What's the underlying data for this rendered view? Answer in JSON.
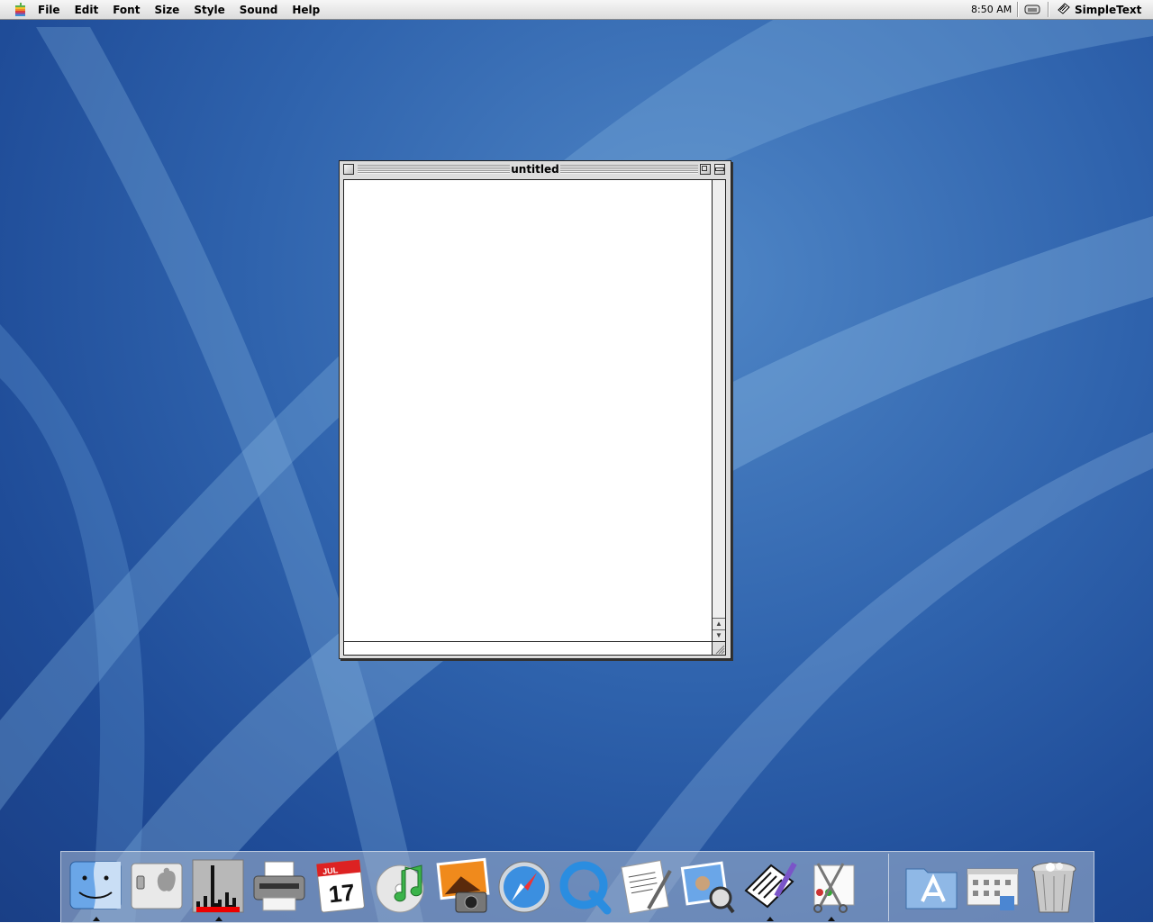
{
  "menubar": {
    "items": [
      "File",
      "Edit",
      "Font",
      "Size",
      "Style",
      "Sound",
      "Help"
    ],
    "clock": "8:50 AM",
    "active_app": "SimpleText"
  },
  "window": {
    "title": "untitled"
  },
  "dock": {
    "items": [
      {
        "name": "finder",
        "icon": "finder-icon",
        "running": true
      },
      {
        "name": "classic",
        "icon": "classic-icon",
        "running": false
      },
      {
        "name": "activity-monitor",
        "icon": "cpu-monitor-icon",
        "running": true
      },
      {
        "name": "printer-setup",
        "icon": "printer-icon",
        "running": false
      },
      {
        "name": "ical",
        "icon": "calendar-icon",
        "running": false,
        "calendar_month": "JUL",
        "calendar_day": "17"
      },
      {
        "name": "itunes",
        "icon": "itunes-icon",
        "running": false
      },
      {
        "name": "iphoto",
        "icon": "iphoto-icon",
        "running": false
      },
      {
        "name": "safari",
        "icon": "safari-icon",
        "running": false
      },
      {
        "name": "quicktime",
        "icon": "quicktime-icon",
        "running": false
      },
      {
        "name": "textedit",
        "icon": "textedit-icon",
        "running": false
      },
      {
        "name": "preview",
        "icon": "preview-icon",
        "running": false
      },
      {
        "name": "simpletext",
        "icon": "simpletext-icon",
        "running": true
      },
      {
        "name": "scrapbook",
        "icon": "scissors-icon",
        "running": true
      },
      {
        "name": "applications-folder",
        "icon": "applications-folder-icon",
        "running": false
      },
      {
        "name": "system-preferences",
        "icon": "system-preferences-icon",
        "running": false
      },
      {
        "name": "trash",
        "icon": "trash-icon",
        "running": false
      }
    ]
  },
  "colors": {
    "desktop": "#2f63ad",
    "menubar": "#dcdcdc",
    "window_frame": "#dddddd"
  }
}
